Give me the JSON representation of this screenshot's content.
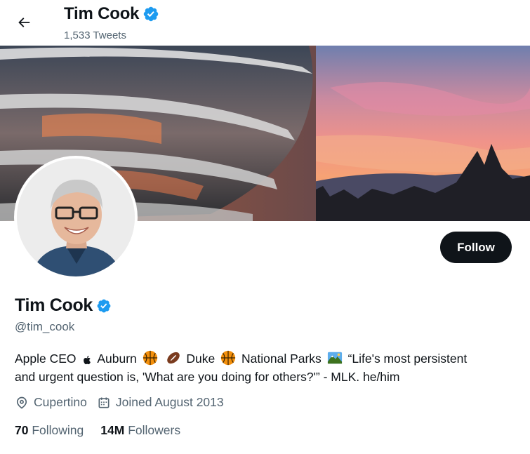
{
  "header": {
    "name": "Tim Cook",
    "tweet_count": "1,533 Tweets"
  },
  "profile": {
    "name": "Tim Cook",
    "handle": "@tim_cook",
    "follow_label": "Follow",
    "bio": {
      "part1": "Apple CEO",
      "part2": "Auburn",
      "part3": "Duke",
      "part4": "National Parks",
      "part5": "“Life's most persistent",
      "line2": "and urgent question is, 'What are you doing for others?'” - MLK. he/him"
    },
    "location": "Cupertino",
    "joined": "Joined August 2013",
    "following_count": "70",
    "following_label": "Following",
    "followers_count": "14M",
    "followers_label": "Followers"
  },
  "icons": {
    "back": "arrow-left-icon",
    "verified": "verified-badge-icon",
    "location": "location-pin-icon",
    "calendar": "calendar-icon",
    "apple": "apple-logo-icon",
    "basketball": "basketball-emoji",
    "football": "football-emoji",
    "park": "national-park-emoji"
  },
  "colors": {
    "accent": "#1d9bf0",
    "text": "#0f1419",
    "secondary": "#536471",
    "button": "#0f1419"
  }
}
